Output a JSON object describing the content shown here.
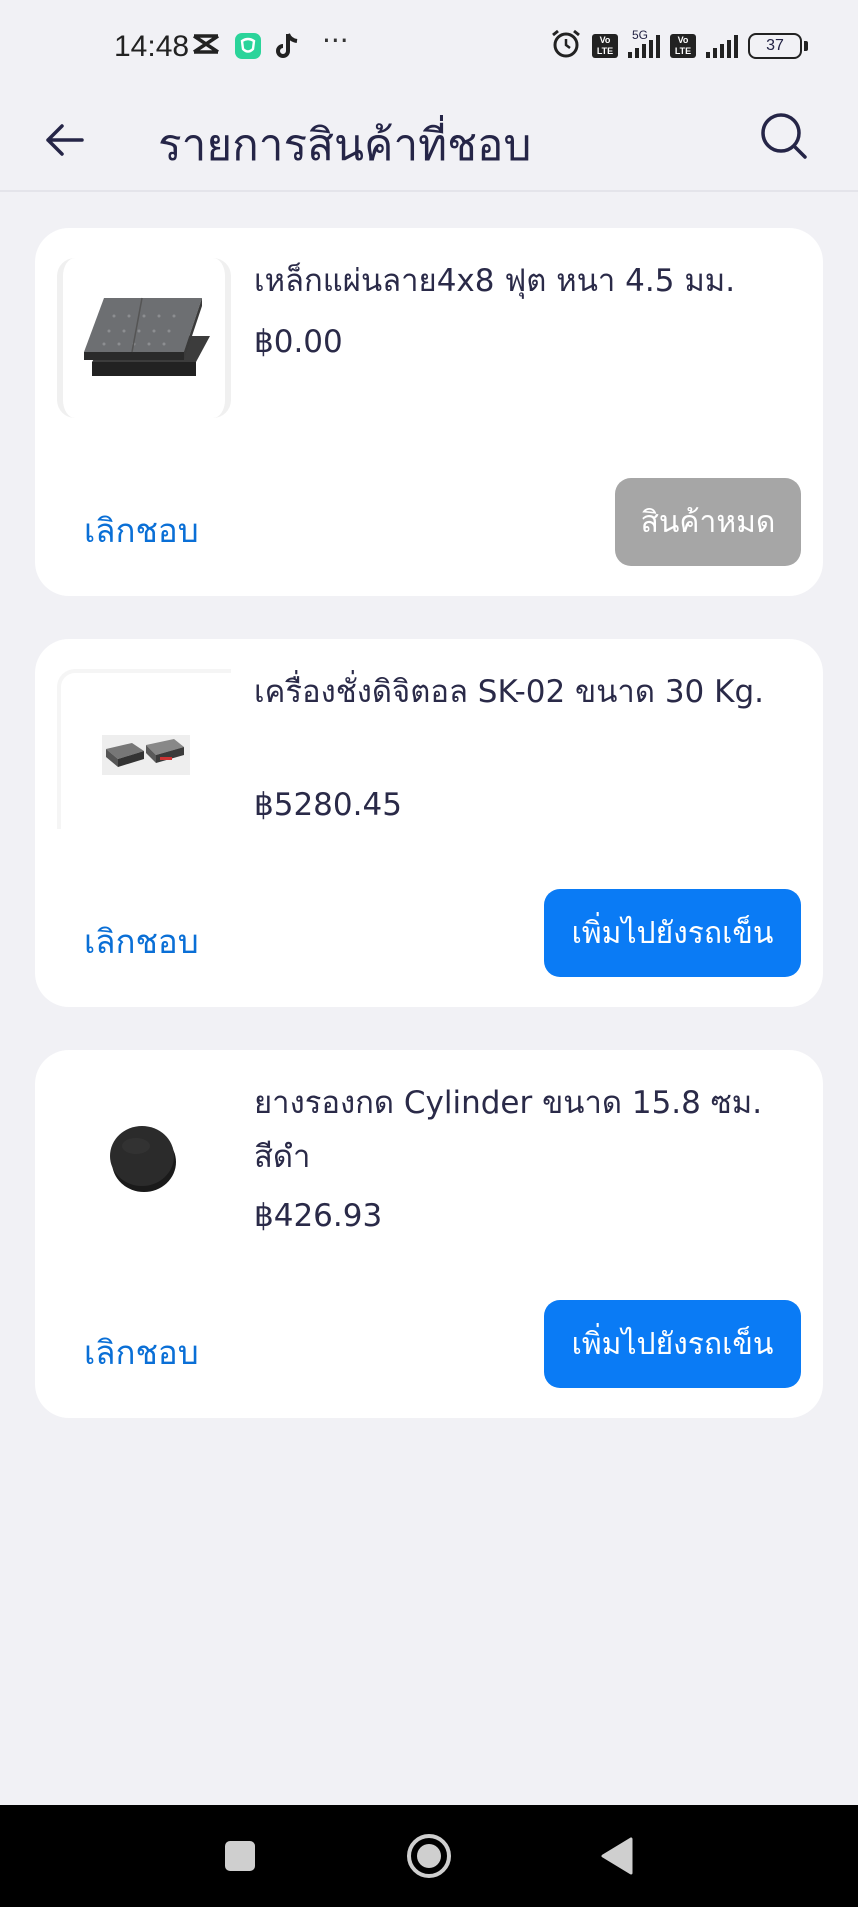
{
  "status_bar": {
    "time": "14:48",
    "more": "···",
    "network": "5G",
    "volte": "Vo LTE",
    "battery": "37"
  },
  "header": {
    "title": "รายการสินค้าที่ชอบ",
    "back_icon": "arrow-left-icon",
    "search_icon": "search-icon"
  },
  "products": [
    {
      "name": "เหล็กแผ่นลาย4x8 ฟุต หนา 4.5 มม.",
      "price": "฿0.00",
      "unfavorite_label": "เลิกชอบ",
      "action_label": "สินค้าหมด",
      "in_stock": false,
      "image": "steel-sheet-image"
    },
    {
      "name": "เครื่องชั่งดิจิตอล SK-02 ขนาด 30 Kg.",
      "price": "฿5280.45",
      "unfavorite_label": "เลิกชอบ",
      "action_label": "เพิ่มไปยังรถเข็น",
      "in_stock": true,
      "image": "digital-scale-image"
    },
    {
      "name": "ยางรองกด Cylinder ขนาด 15.8 ซม. สีดำ",
      "price": "฿426.93",
      "unfavorite_label": "เลิกชอบ",
      "action_label": "เพิ่มไปยังรถเข็น",
      "in_stock": true,
      "image": "rubber-cylinder-image"
    }
  ],
  "colors": {
    "accent": "#0a7bf5",
    "link": "#0a6fd6",
    "disabled": "#a6a6a6",
    "background": "#f1f1f5"
  }
}
